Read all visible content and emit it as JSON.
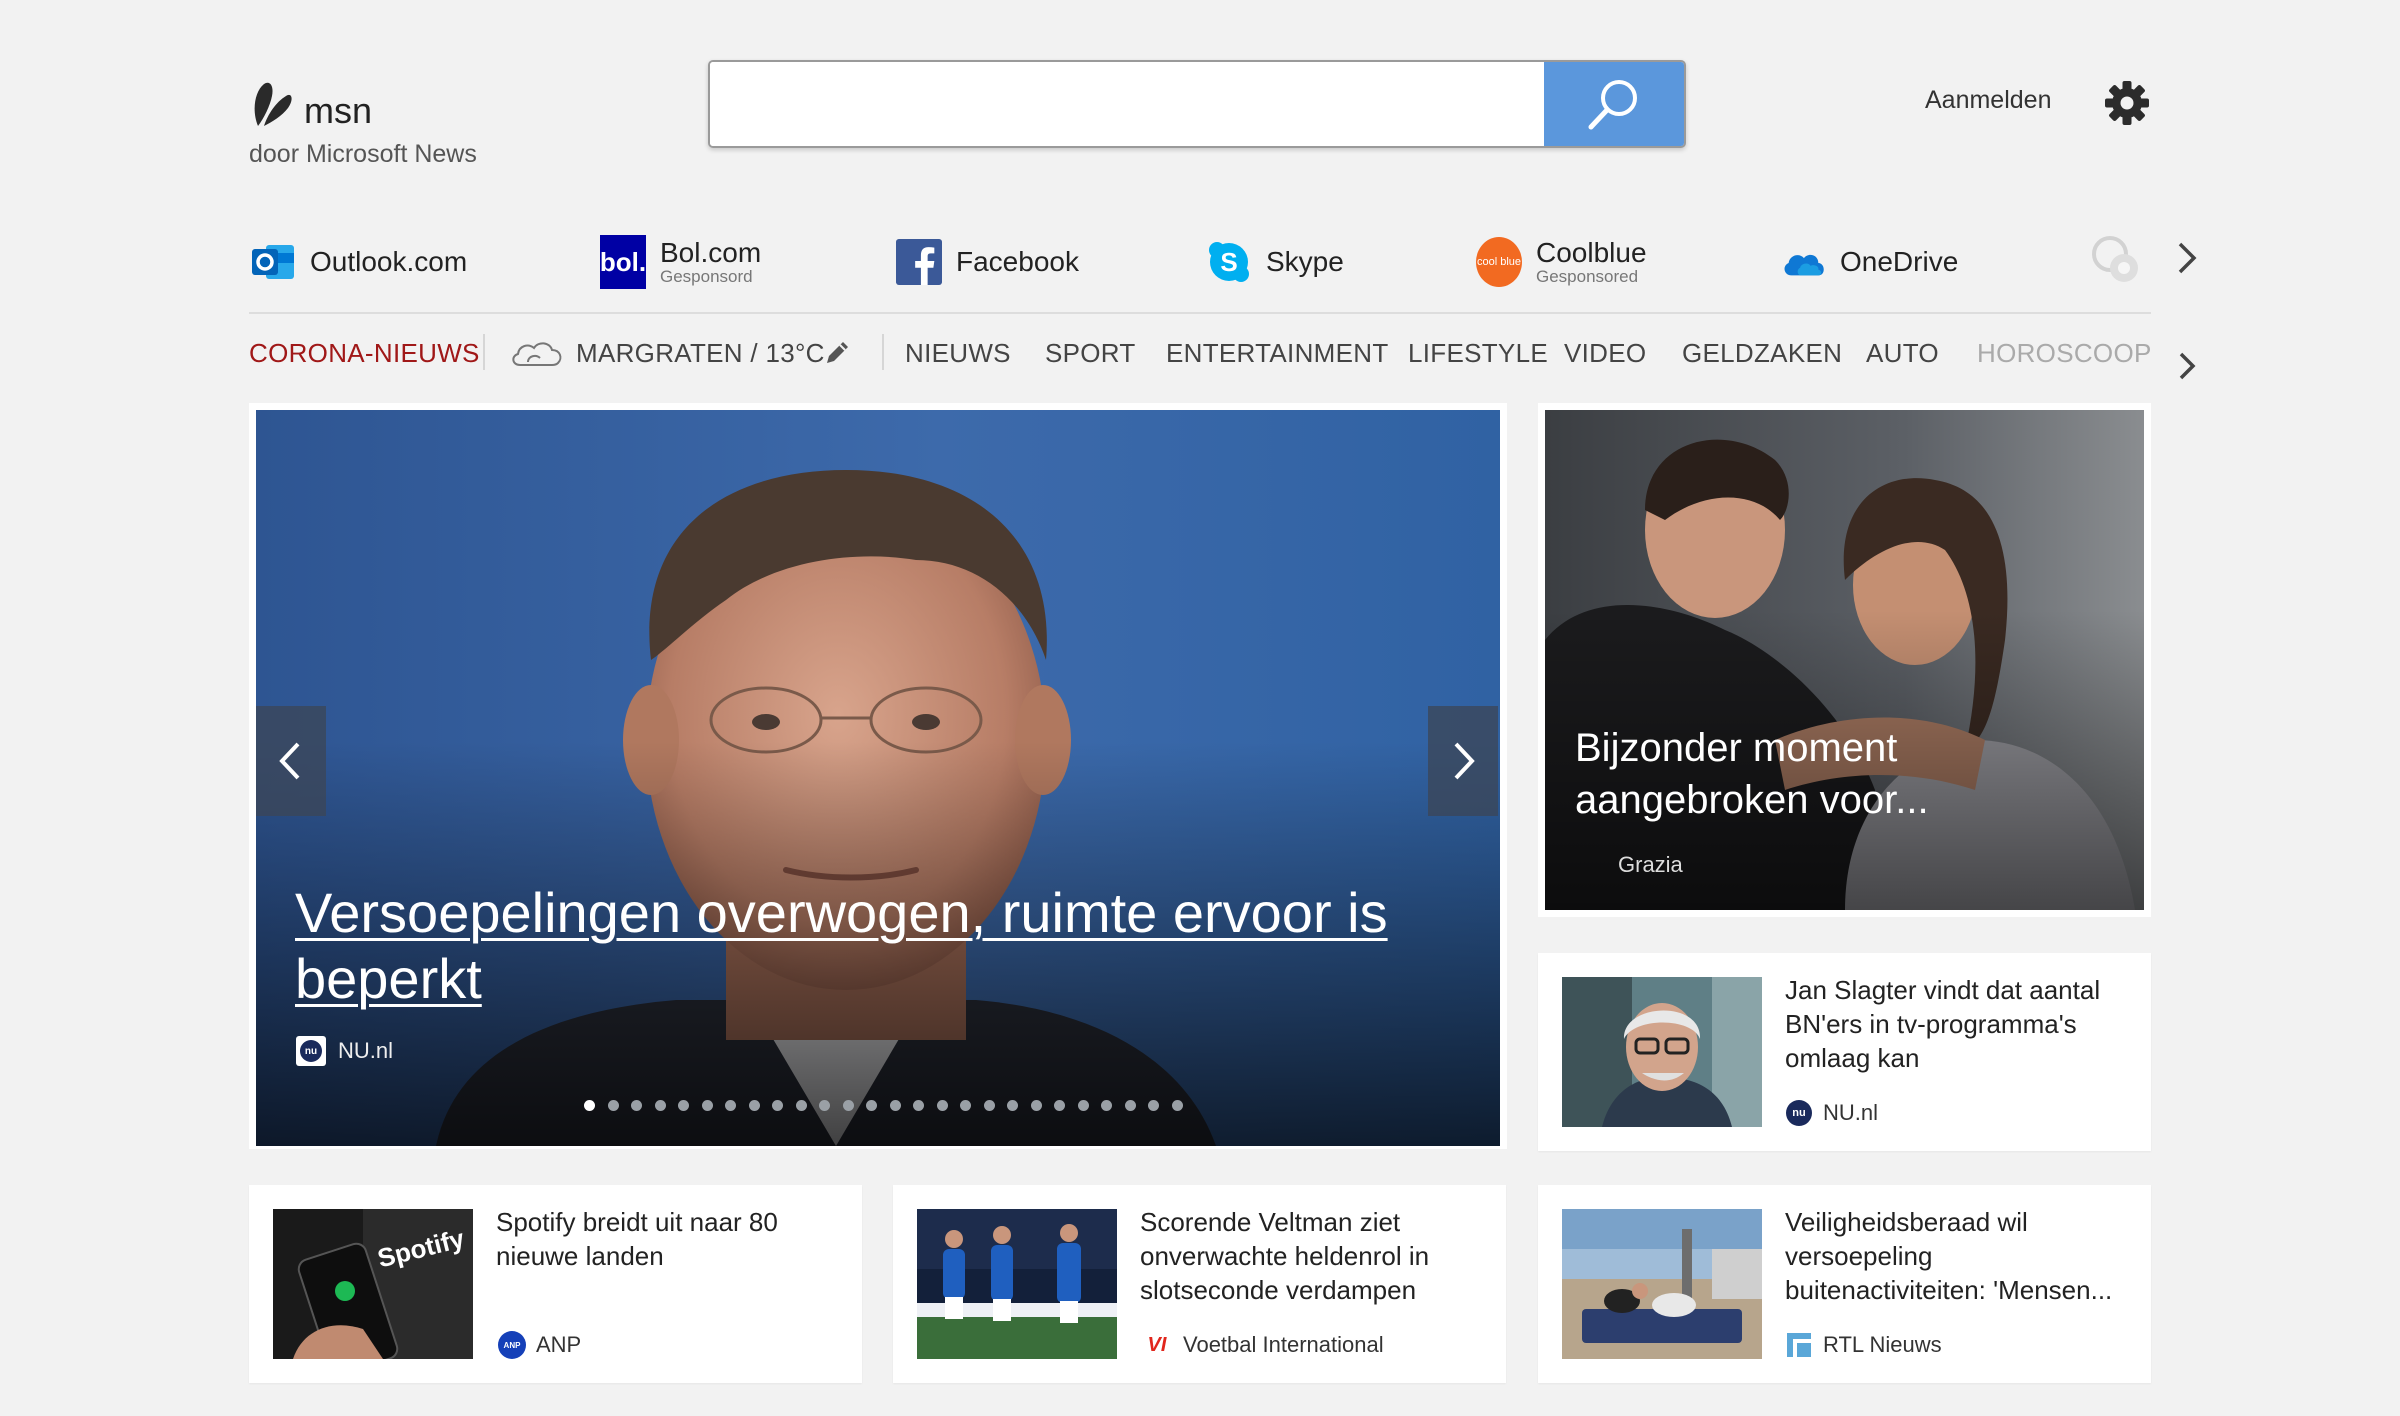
{
  "header": {
    "brand": "msn",
    "tagline": "door Microsoft News",
    "search": {
      "value": "",
      "placeholder": ""
    },
    "signin_label": "Aanmelden"
  },
  "quick_links": [
    {
      "label": "Outlook.com",
      "sponsored": "",
      "icon": "outlook-icon"
    },
    {
      "label": "Bol.com",
      "sponsored": "Gesponsord",
      "icon": "bol-icon",
      "icon_text": "bol."
    },
    {
      "label": "Facebook",
      "sponsored": "",
      "icon": "facebook-icon"
    },
    {
      "label": "Skype",
      "sponsored": "",
      "icon": "skype-icon"
    },
    {
      "label": "Coolblue",
      "sponsored": "Gesponsored",
      "icon": "coolblue-icon",
      "icon_text": "cool blue"
    },
    {
      "label": "OneDrive",
      "sponsored": "",
      "icon": "onedrive-icon"
    }
  ],
  "nav": {
    "corona": "CORONA-NIEUWS",
    "weather": "MARGRATEN / 13°C",
    "items": [
      "NIEUWS",
      "SPORT",
      "ENTERTAINMENT",
      "LIFESTYLE",
      "VIDEO",
      "GELDZAKEN",
      "AUTO",
      "HOROSCOOP"
    ]
  },
  "hero": {
    "title": "Versoepelingen overwogen, ruimte ervoor is beperkt",
    "source": "NU.nl",
    "source_icon_text": "nu",
    "slide_count": 26,
    "active_slide": 1
  },
  "feature": {
    "title": "Bijzonder moment aangebroken voor...",
    "source": "Grazia"
  },
  "cards": [
    {
      "title": "Jan Slagter vindt dat aantal BN'ers in tv-programma's omlaag kan",
      "source": "NU.nl",
      "source_icon_text": "nu"
    },
    {
      "title": "Spotify breidt uit naar 80 nieuwe landen",
      "source": "ANP",
      "source_icon_text": "ANP",
      "thumb_text": "Spotify"
    },
    {
      "title": "Scorende Veltman ziet onverwachte heldenrol in slotseconde verdampen",
      "source": "Voetbal International",
      "source_icon_text": "VI"
    },
    {
      "title": "Veiligheidsberaad wil versoepeling buitenactiviteiten: 'Mensen...",
      "source": "RTL Nieuws"
    }
  ],
  "colors": {
    "page_bg": "#f2f2f2",
    "search_button": "#5b97dc",
    "corona_red": "#a01818",
    "facebook_blue": "#3b5998",
    "skype_blue": "#00aff0",
    "bol_blue": "#0000a4",
    "coolblue_orange": "#f26a21"
  }
}
